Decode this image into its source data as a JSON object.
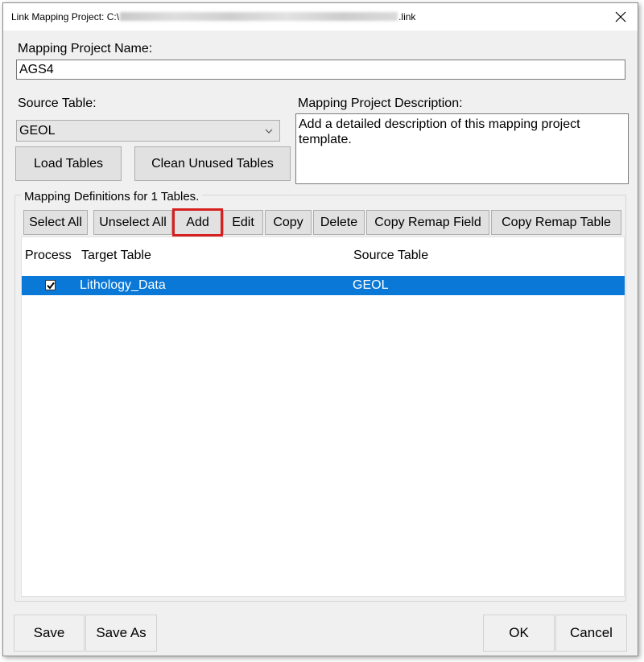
{
  "window": {
    "title_prefix": "Link Mapping Project: C:\\",
    "title_suffix": ".link"
  },
  "project_name": {
    "label": "Mapping Project Name:",
    "value": "AGS4"
  },
  "source_table": {
    "label": "Source Table:",
    "selected": "GEOL"
  },
  "description": {
    "label": "Mapping Project Description:",
    "value": "Add a detailed description of this mapping project template."
  },
  "actions": {
    "load_tables": "Load Tables",
    "clean_unused": "Clean Unused Tables"
  },
  "definitions": {
    "group_title": "Mapping Definitions for 1 Tables.",
    "toolbar": {
      "select_all": "Select All",
      "unselect_all": "Unselect All",
      "add": "Add",
      "edit": "Edit",
      "copy": "Copy",
      "delete": "Delete",
      "copy_remap_field": "Copy Remap Field",
      "copy_remap_table": "Copy Remap Table"
    },
    "columns": {
      "process": "Process",
      "target": "Target Table",
      "source": "Source Table"
    },
    "rows": [
      {
        "process": true,
        "target": "Lithology_Data",
        "source": "GEOL"
      }
    ]
  },
  "footer": {
    "save": "Save",
    "save_as": "Save As",
    "ok": "OK",
    "cancel": "Cancel"
  },
  "colors": {
    "selection": "#0a78d7",
    "highlight_outline": "#d62020",
    "window_bg": "#f0f0f0"
  }
}
